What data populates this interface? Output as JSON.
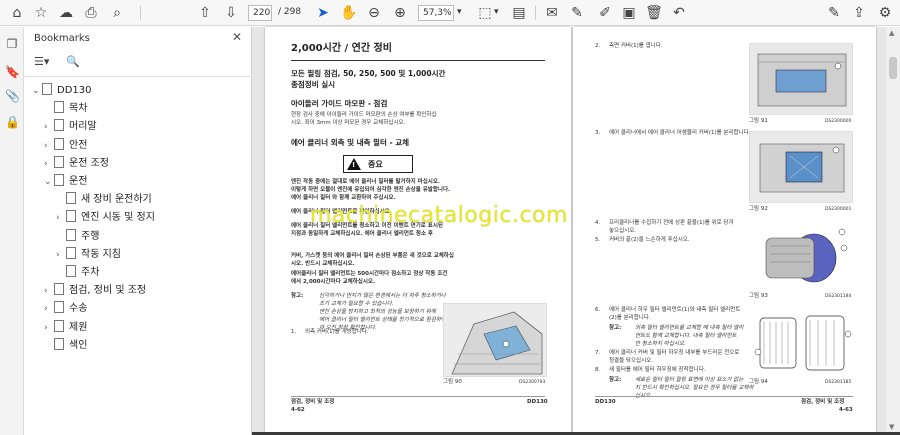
{
  "toolbar": {
    "page_current": "220",
    "page_total": "/ 298",
    "zoom": "57,3%",
    "zoom_caret": "▾",
    "view_caret": "▾"
  },
  "panel": {
    "title": "Bookmarks",
    "close": "✕",
    "items": [
      {
        "label": "DD130",
        "chev": "⌄"
      },
      {
        "label": "목차",
        "chev": ""
      },
      {
        "label": "머리말",
        "chev": "›"
      },
      {
        "label": "안전",
        "chev": "›"
      },
      {
        "label": "운전 조정",
        "chev": "›"
      },
      {
        "label": "운전",
        "chev": "⌄"
      },
      {
        "label": "새 장비 운전하기",
        "chev": ""
      },
      {
        "label": "엔진 시동 및 정지",
        "chev": "›"
      },
      {
        "label": "주행",
        "chev": ""
      },
      {
        "label": "작동 지침",
        "chev": "›"
      },
      {
        "label": "주차",
        "chev": ""
      },
      {
        "label": "점검, 정비 및 조정",
        "chev": "›"
      },
      {
        "label": "수송",
        "chev": "›"
      },
      {
        "label": "제원",
        "chev": "›"
      },
      {
        "label": "색인",
        "chev": ""
      }
    ]
  },
  "left_page": {
    "heading": "2,000시간 / 연간 정비",
    "sub1": "모든 필링 점검, 50, 250, 500 및 1,000시간",
    "sub2": "종점정비 실시",
    "sec1": "아이들러 가이드 마모판 - 점검",
    "sec1_l1": "현장 검사 중에 아이들러 가이드 마모판의 손상 여부를 확인하십",
    "sec1_l2": "시오. 좌이 3mm 이상 마모된 경우 교체하십시오.",
    "sec2": "에어 클리너 외측 및 내측 필터 - 교체",
    "warn": "중요",
    "w1": "엔진 작동 중에는 절대로 에어 클리너 필터를 탈거하지 마십시오.",
    "w2": "이렇게 하면 오물이 엔진에 유입되어 심각한 엔진 손상을 유발합니다.",
    "w3": "에어 클리너 필터 와 함께 교환하여 주십시오.",
    "w4": "에어 클리너 필터 엘리먼트를 확인하십시오.",
    "w5": "에어 클리너 필터 엘리먼트를 청소하고 이전 이벤트 연기로 표시된",
    "w6": "지점과 동일하게 교체하십시오. 에어 클리너 엘리먼트 청소 후",
    "w7": "커버, 가스켓 등의 에어 클리너 필터 손상된 부품은 새 것으로 교체하십",
    "w8": "시오. 반드시 교체하십시오.",
    "w9": "에어클리너 필터 엘리먼트는 500시간마다 점소하고 정상 작동 조건",
    "w10": "에서 2,000시간마다 교체하십시오.",
    "note_lbl": "참고:",
    "n1": "심각하거나 먼지가 많은 환경에서는 더 자주 청소하거나",
    "n2": "조기 교체가 필요할 수 있습니다.",
    "n3": "엔진 손상을 방지하고 최적의 성능을 보장하기 위해",
    "n4": "에어 클리너 필터 엘리먼트 상태를 정기적으로 점검하여",
    "n5": "야 오진 장착 확인합니다.",
    "step1_no": "1.",
    "step1": "외측 커버(1)를 개방합니다.",
    "fig_label": "그림 90",
    "fig_code": "DS2300793",
    "foot_title": "점검, 정비 및 조정",
    "foot_page": "4-62",
    "foot_model": "DD130"
  },
  "right_page": {
    "s2_no": "2.",
    "s2": "측면 커버(1)를 엽니다.",
    "fig91": "그림 91",
    "fig91_code": "DS2300000",
    "s3_no": "3.",
    "s3": "에어 클리너에서 에어 클리너 어셈블리 커버(1)를 분리합니다.",
    "fig92": "그림 92",
    "fig92_code": "DS2300001",
    "s4_no": "4.",
    "s4a": "프리클리너를 수집하기 전에 상판 끝을(1)를 위로 당겨",
    "s4b": "놓으십시오.",
    "s5_no": "5.",
    "s5": "커버의 끝(2)을 느슨하게 푸십시오.",
    "fig93": "그림 93",
    "fig93_code": "DS2301184",
    "s6_no": "6.",
    "s6a": "에어 클리너 하우 필터 엘리먼트(1)와 내측 필터 엘리먼트",
    "s6b": "(2)를 분리합니다.",
    "note_lbl": "참고:",
    "n6a": "외측 필터 엘리먼트를 교체할 때 내측 필터 엘리",
    "n6b": "먼트도 함께 교체합니다. 내측 필터 엘리먼트",
    "n6c": "만 청소하지 마십시오.",
    "s7_no": "7.",
    "s7a": "에어 클리너 커버 및 필터 하우징 내부를 부드러운 천으로",
    "s7b": "청결을 닦으십시오.",
    "s8_no": "8.",
    "s8": "새 필터를 에어 필터 하우징에 장착합니다.",
    "note2_lbl": "참고:",
    "n8a": "새로운 필터 필터 월링 표면에 이상 요소가 없는",
    "n8b": "지 반드시 확인하십시오. 필요한 경우 필터를 교체하",
    "n8c": "십시오.",
    "fig94": "그림 94",
    "fig94_code": "DS2301185",
    "foot_model": "DD130",
    "foot_title": "점검, 정비 및 조정",
    "foot_page": "4-63"
  },
  "watermark": "machinecatalogic.com"
}
